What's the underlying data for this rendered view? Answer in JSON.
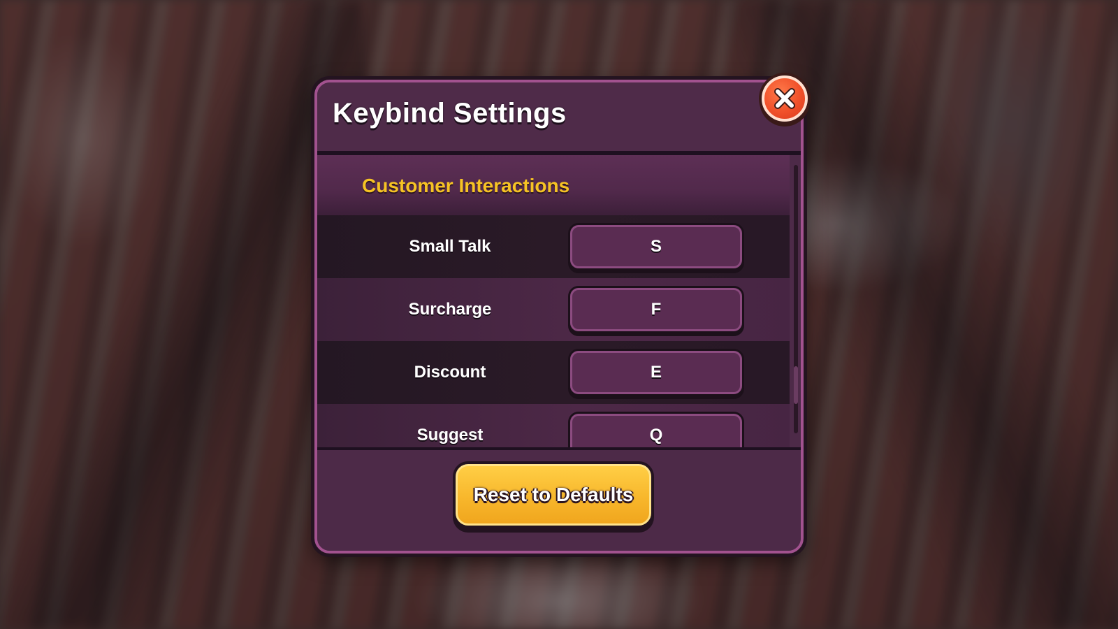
{
  "dialog": {
    "title": "Keybind Settings"
  },
  "section": {
    "title": "Customer Interactions"
  },
  "keybinds": [
    {
      "action": "Small Talk",
      "key": "S"
    },
    {
      "action": "Surcharge",
      "key": "F"
    },
    {
      "action": "Discount",
      "key": "E"
    },
    {
      "action": "Suggest",
      "key": "Q"
    }
  ],
  "footer": {
    "reset_label": "Reset to Defaults"
  },
  "icons": {
    "close": "close-icon"
  },
  "colors": {
    "dialog_bg": "#4d2a48",
    "dialog_border": "#a2528f",
    "section_title": "#f6c324",
    "reset_button": "#f7b52a",
    "close_button": "#f0502a"
  }
}
